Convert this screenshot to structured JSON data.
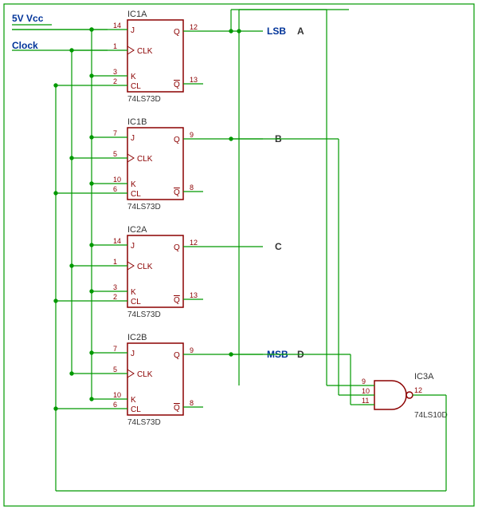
{
  "inputs": {
    "vcc": "5V Vcc",
    "clock": "Clock"
  },
  "flipflops": [
    {
      "ref": "IC1A",
      "part": "74LS73D",
      "pins": {
        "j": "14",
        "clk": "1",
        "k": "3",
        "cl": "2",
        "q": "12",
        "qbar": "13"
      },
      "labels": {
        "j": "J",
        "clk": "CLK",
        "k": "K",
        "cl": "CL",
        "q": "Q",
        "qbar": "Q"
      },
      "out": {
        "tag": "LSB",
        "letter": "A"
      }
    },
    {
      "ref": "IC1B",
      "part": "74LS73D",
      "pins": {
        "j": "7",
        "clk": "5",
        "k": "10",
        "cl": "6",
        "q": "9",
        "qbar": "8"
      },
      "labels": {
        "j": "J",
        "clk": "CLK",
        "k": "K",
        "cl": "CL",
        "q": "Q",
        "qbar": "Q"
      },
      "out": {
        "tag": "",
        "letter": "B"
      }
    },
    {
      "ref": "IC2A",
      "part": "74LS73D",
      "pins": {
        "j": "14",
        "clk": "1",
        "k": "3",
        "cl": "2",
        "q": "12",
        "qbar": "13"
      },
      "labels": {
        "j": "J",
        "clk": "CLK",
        "k": "K",
        "cl": "CL",
        "q": "Q",
        "qbar": "Q"
      },
      "out": {
        "tag": "",
        "letter": "C"
      }
    },
    {
      "ref": "IC2B",
      "part": "74LS73D",
      "pins": {
        "j": "7",
        "clk": "5",
        "k": "10",
        "cl": "6",
        "q": "9",
        "qbar": "8"
      },
      "labels": {
        "j": "J",
        "clk": "CLK",
        "k": "K",
        "cl": "CL",
        "q": "Q",
        "qbar": "Q"
      },
      "out": {
        "tag": "MSB",
        "letter": "D"
      }
    }
  ],
  "nand": {
    "ref": "IC3A",
    "part": "74LS10D",
    "pins": {
      "in1": "9",
      "in2": "10",
      "in3": "11",
      "out": "12"
    }
  }
}
